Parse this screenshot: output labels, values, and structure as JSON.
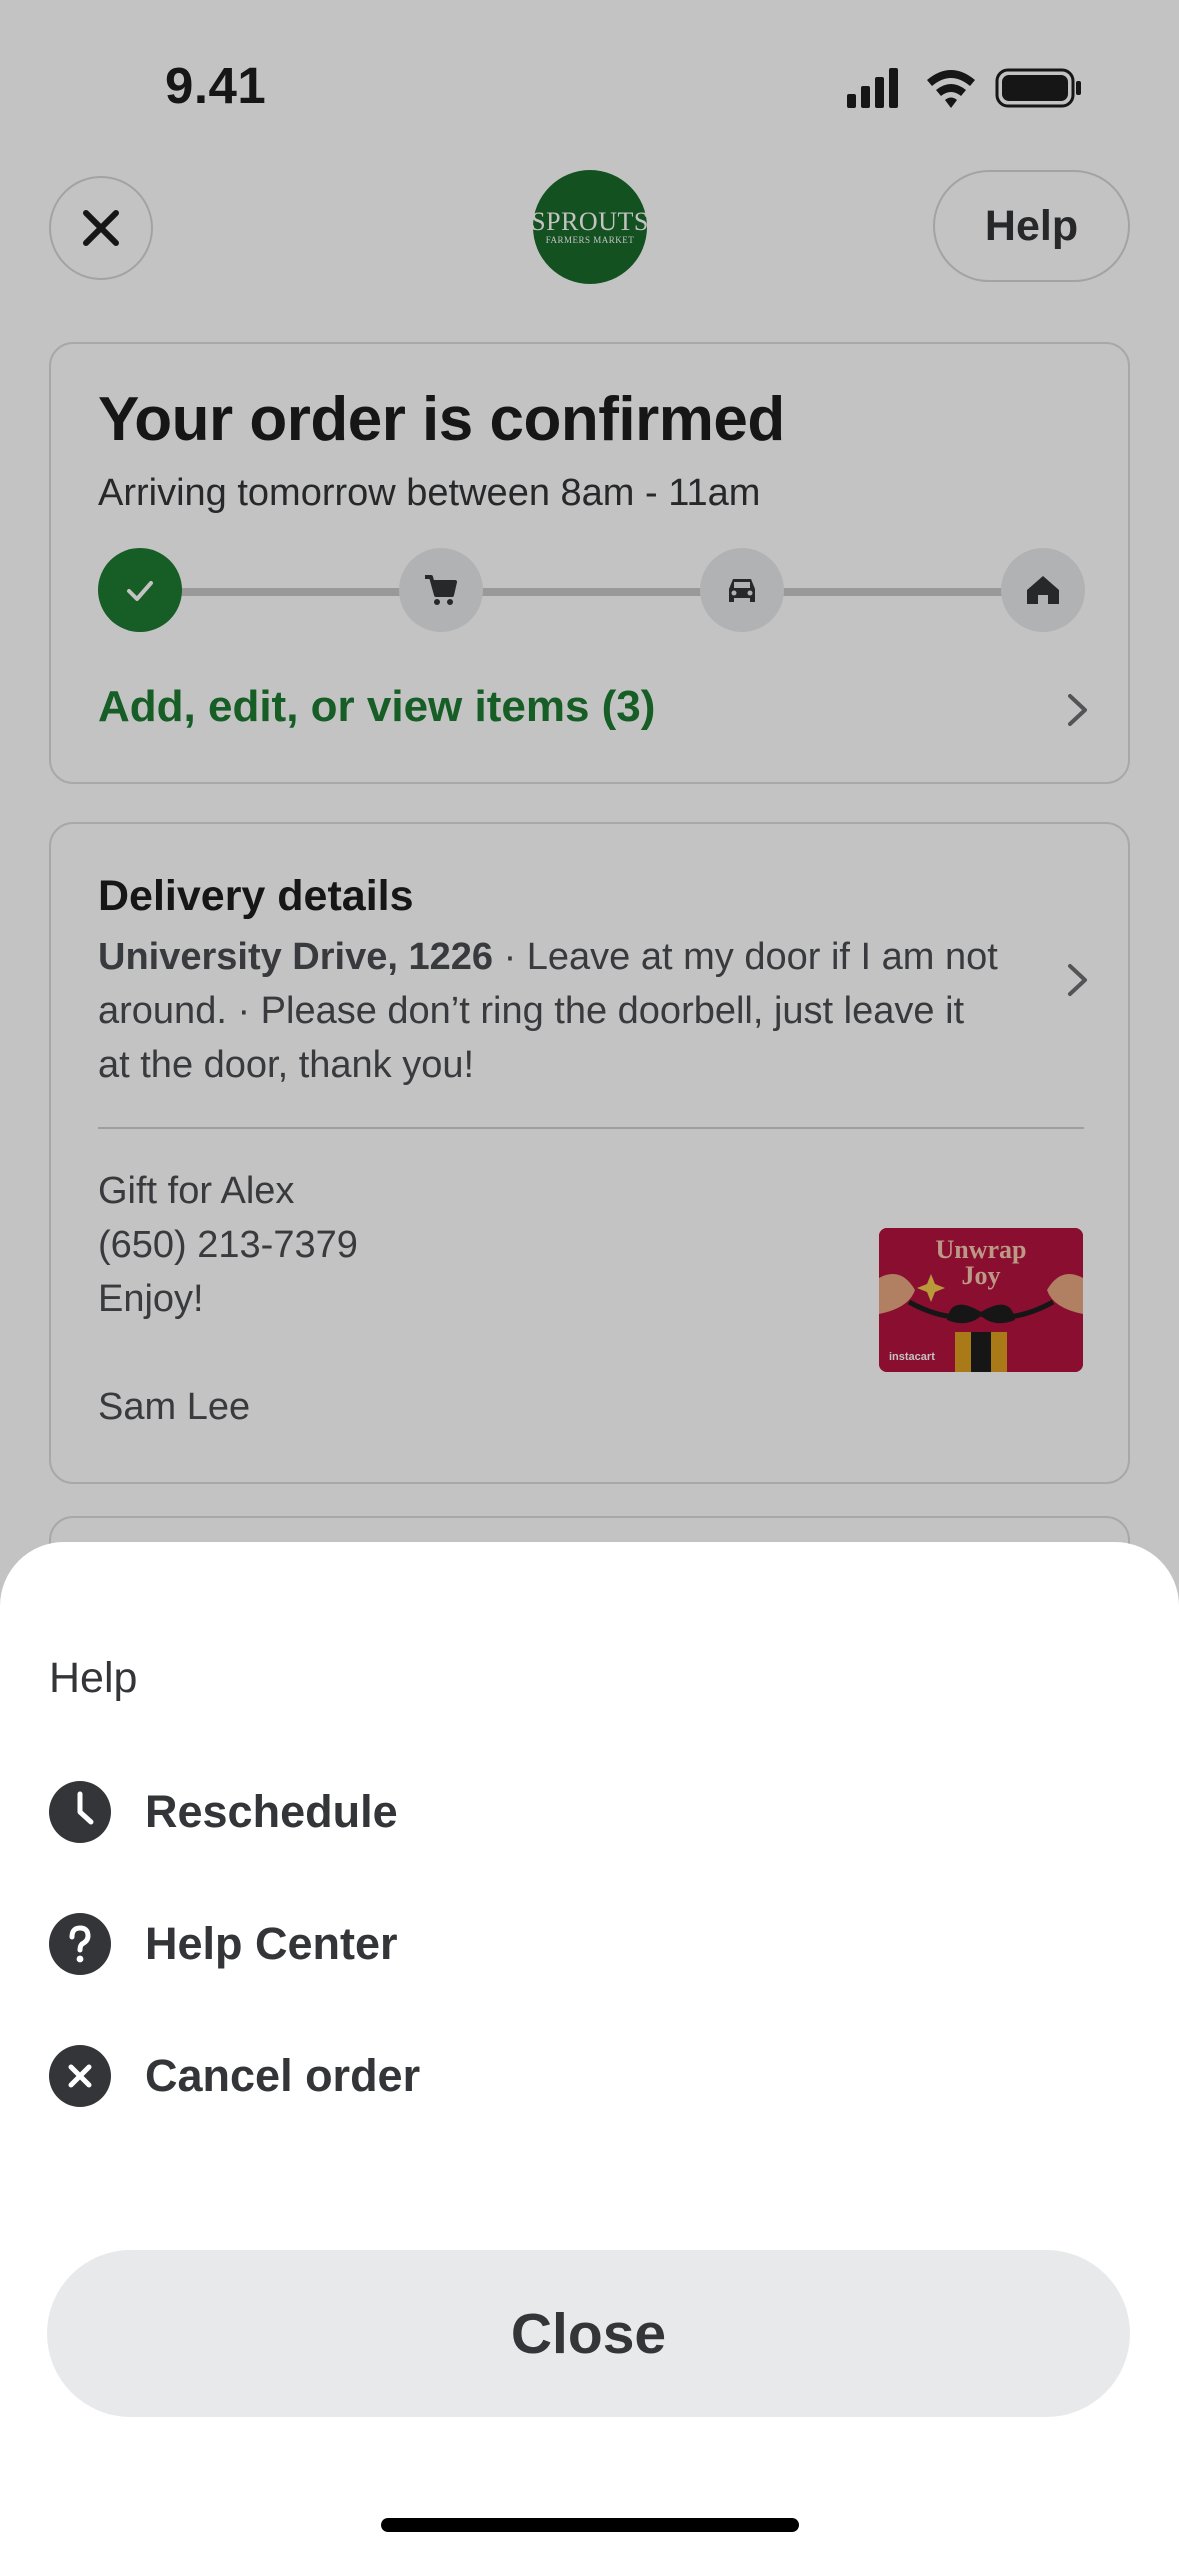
{
  "status_bar": {
    "time": "9.41"
  },
  "header": {
    "help_label": "Help",
    "logo_line1": "SPROUTS",
    "logo_line2": "FARMERS MARKET"
  },
  "order": {
    "title": "Your order is confirmed",
    "subtitle": "Arriving tomorrow between 8am - 11am",
    "items_link": "Add, edit, or view items (3)",
    "progress_steps": [
      "confirmed",
      "shopping",
      "delivering",
      "delivered"
    ],
    "current_step": 1
  },
  "delivery": {
    "title": "Delivery details",
    "address": "University Drive, 1226",
    "instructions": " · Leave at my door if I am not around. · Please don’t ring the doorbell, just leave it at the door, thank you!",
    "gift_recipient": "Gift for Alex",
    "gift_phone": "(650) 213-7379",
    "gift_message": "Enjoy!",
    "gift_sender": "Sam Lee",
    "gift_card_line1": "Unwrap",
    "gift_card_line2": "Joy",
    "gift_card_brand": "instacart"
  },
  "sheet": {
    "title": "Help",
    "items": [
      {
        "label": "Reschedule",
        "icon": "clock-icon"
      },
      {
        "label": "Help Center",
        "icon": "question-icon"
      },
      {
        "label": "Cancel order",
        "icon": "x-circle-icon"
      }
    ],
    "close_label": "Close"
  },
  "colors": {
    "brand_green": "#1d7a32",
    "accent_dark": "#343538",
    "gift_card": "#b5133f"
  }
}
